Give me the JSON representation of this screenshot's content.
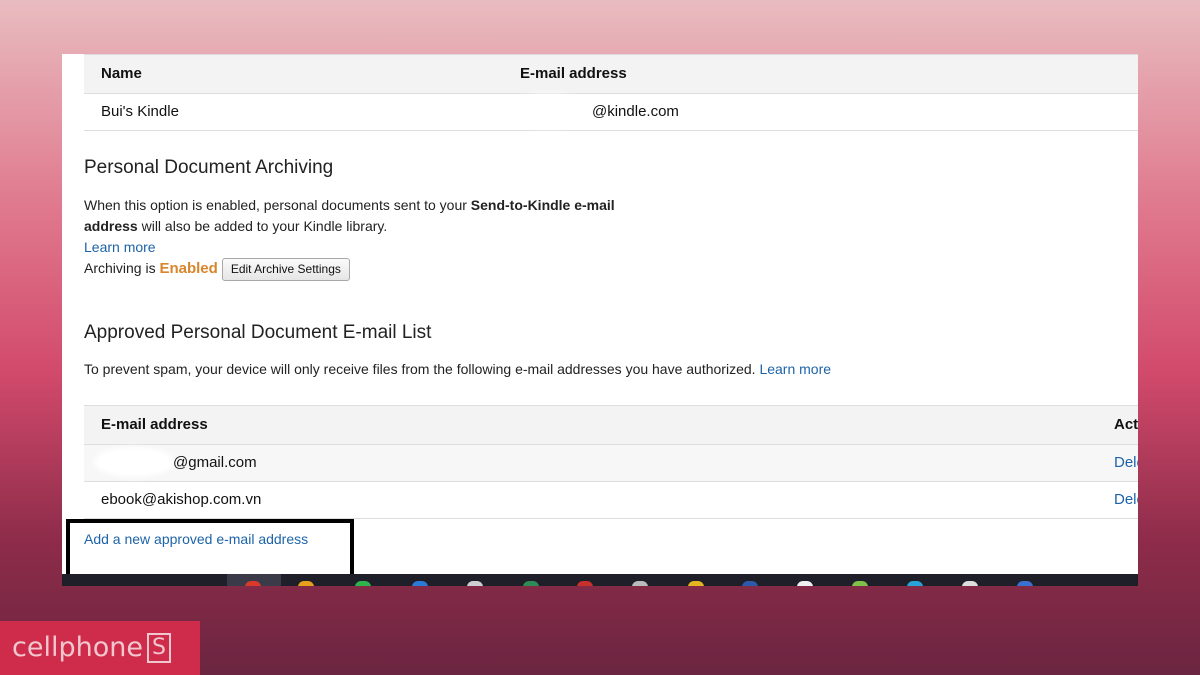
{
  "devices_table": {
    "headers": {
      "name": "Name",
      "email": "E-mail address"
    },
    "rows": [
      {
        "name": "Bui's Kindle",
        "email": "@kindle.com"
      }
    ]
  },
  "archiving": {
    "title": "Personal Document Archiving",
    "desc_part1": "When this option is enabled, personal documents sent to your ",
    "desc_bold1": "Send-to-Kindle e-mail",
    "desc_bold2": "address",
    "desc_part2": " will also be added to your Kindle library.",
    "learn_more": "Learn more",
    "status_prefix": "Archiving is ",
    "status_value": "Enabled",
    "edit_button": "Edit Archive Settings"
  },
  "approved": {
    "title": "Approved Personal Document E-mail List",
    "desc": "To prevent spam, your device will only receive files from the following e-mail addresses you have authorized.",
    "learn_more": "Learn more",
    "headers": {
      "email": "E-mail address",
      "actions": "Act"
    },
    "rows": [
      {
        "email": "@gmail.com",
        "action": "Dele"
      },
      {
        "email": "ebook@akishop.com.vn",
        "action": "Dele"
      }
    ],
    "add_link": "Add a new approved e-mail address"
  },
  "watermark": {
    "text": "cellphone",
    "mark": "S"
  },
  "colors": {
    "link": "#1d63a8",
    "enabled": "#d9852b",
    "brand": "#cf2b4a"
  }
}
